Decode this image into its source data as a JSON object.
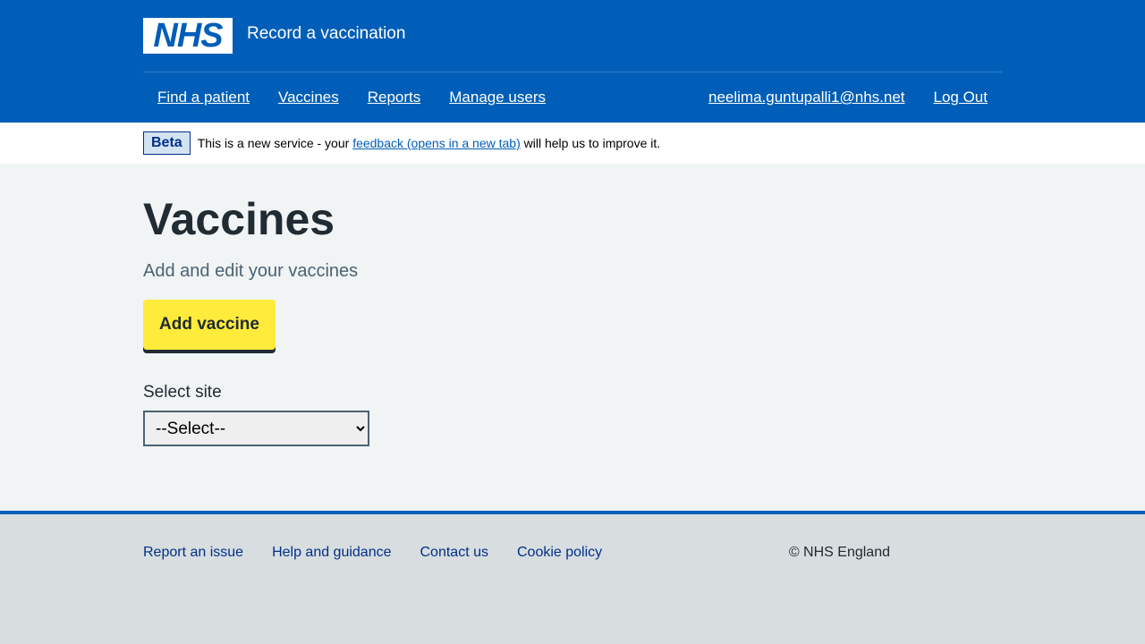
{
  "header": {
    "logo_text": "NHS",
    "service_name": "Record a vaccination",
    "nav": [
      "Find a patient",
      "Vaccines",
      "Reports",
      "Manage users"
    ],
    "user_email": "neelima.guntupalli1@nhs.net",
    "logout": "Log Out"
  },
  "phase_banner": {
    "tag": "Beta",
    "text_before": "This is a new service - your",
    "link": "feedback (opens in a new tab)",
    "text_after": "will help us to improve it."
  },
  "main": {
    "title": "Vaccines",
    "subtitle": "Add and edit your vaccines",
    "add_button": "Add vaccine",
    "site_label": "Select site",
    "site_selected": "--Select--"
  },
  "footer": {
    "links": [
      "Report an issue",
      "Help and guidance",
      "Contact us",
      "Cookie policy"
    ],
    "copyright": "© NHS England"
  },
  "colors": {
    "nhs_blue": "#005eb8",
    "button_yellow": "#ffeb3b",
    "page_bg": "#f0f4f5",
    "footer_bg": "#d8dde0"
  }
}
